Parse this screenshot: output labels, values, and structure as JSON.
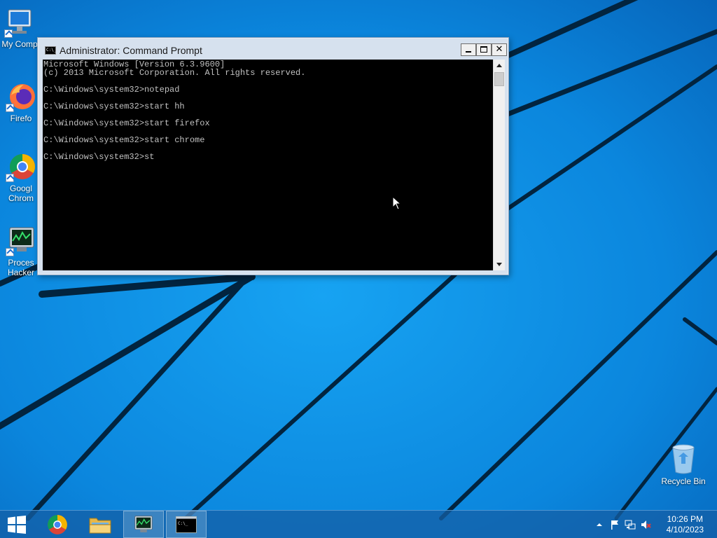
{
  "window": {
    "title": "Administrator:  Command Prompt",
    "title_icon_text": "C:\\_",
    "min_label": "",
    "max_label": "",
    "close_label": "✕"
  },
  "console": {
    "text": "Microsoft Windows [Version 6.3.9600]\n(c) 2013 Microsoft Corporation. All rights reserved.\n\nC:\\Windows\\system32>notepad\n\nC:\\Windows\\system32>start hh\n\nC:\\Windows\\system32>start firefox\n\nC:\\Windows\\system32>start chrome\n\nC:\\Windows\\system32>st"
  },
  "desktop_icons": [
    {
      "name": "My Comp",
      "label": "My Comp",
      "icon": "computer-icon"
    },
    {
      "name": "Firefox",
      "label": "Firefo",
      "icon": "firefox-icon"
    },
    {
      "name": "Google Chrome",
      "label_line1": "Googl",
      "label_line2": "Chrom",
      "icon": "chrome-icon"
    },
    {
      "name": "Process Hacker",
      "label_line1": "Proces",
      "label_line2": "Hacker",
      "icon": "process-hacker-icon"
    }
  ],
  "recycle_bin": {
    "label": "Recycle Bin"
  },
  "taskbar": {
    "clock_time": "10:26 PM",
    "clock_date": "4/10/2023"
  },
  "colors": {
    "wallpaper": "#0a7fd8",
    "console_bg": "#000000",
    "console_fg": "#c0c0c0",
    "window_frame": "#d6e1ee"
  }
}
